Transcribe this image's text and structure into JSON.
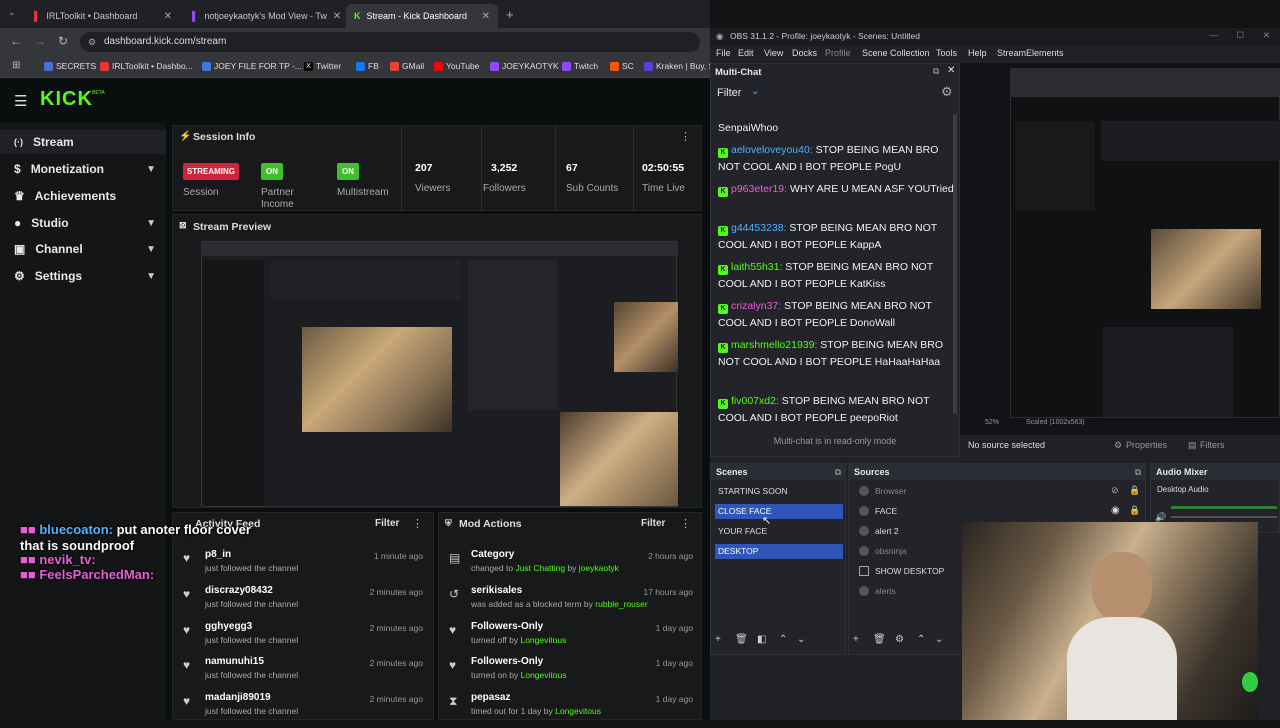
{
  "browser": {
    "tabs": [
      {
        "title": "IRLToolkit • Dashboard"
      },
      {
        "title": "notjoeykaotyk's Mod View - Tw"
      },
      {
        "title": "Stream - Kick Dashboard"
      }
    ],
    "url": "dashboard.kick.com/stream",
    "bookmarks": [
      "SECRETS",
      "IRLToolkit • Dashbo...",
      "JOEY FILE FOR TP -...",
      "Twitter",
      "FB",
      "GMail",
      "YouTube",
      "JOEYKAOTYK",
      "Twitch",
      "SC",
      "Kraken | Buy, S"
    ]
  },
  "kick": {
    "logo": "KICK",
    "logo_sup": "BETA",
    "nav": [
      {
        "label": "Stream",
        "has_chevron": false
      },
      {
        "label": "Monetization",
        "has_chevron": true
      },
      {
        "label": "Achievements",
        "has_chevron": false
      },
      {
        "label": "Studio",
        "has_chevron": true
      },
      {
        "label": "Channel",
        "has_chevron": true
      },
      {
        "label": "Settings",
        "has_chevron": true
      }
    ],
    "session_info": {
      "title": "Session Info",
      "streaming_badge": "STREAMING",
      "session_label": "Session",
      "partner_badge": "ON",
      "partner_label": "Partner Income",
      "multistream_badge": "ON",
      "multistream_label": "Multistream",
      "viewers_value": "207",
      "viewers_label": "Viewers",
      "followers_value": "3,252",
      "followers_label": "Followers",
      "subs_value": "67",
      "subs_label": "Sub Counts",
      "time_value": "02:50:55",
      "time_label": "Time Live"
    },
    "stream_preview_title": "Stream Preview",
    "activity_feed": {
      "title": "Activity Feed",
      "filter": "Filter",
      "items": [
        {
          "name": "p8_in",
          "sub": "just followed the channel",
          "time": "1 minute ago"
        },
        {
          "name": "discrazy08432",
          "sub": "just followed the channel",
          "time": "2 minutes ago"
        },
        {
          "name": "gghyegg3",
          "sub": "just followed the channel",
          "time": "2 minutes ago"
        },
        {
          "name": "namunuhi15",
          "sub": "just followed the channel",
          "time": "2 minutes ago"
        },
        {
          "name": "madanji89019",
          "sub": "just followed the channel",
          "time": "2 minutes ago"
        }
      ]
    },
    "mod_actions": {
      "title": "Mod Actions",
      "filter": "Filter",
      "items": [
        {
          "name": "Category",
          "pre": "changed to ",
          "hl": "Just Chatting",
          "mid": " by ",
          "user": "joeykaotyk",
          "time": "2 hours ago"
        },
        {
          "name": "serikisales",
          "pre": "was added as a blocked term by ",
          "hl": "",
          "mid": "",
          "user": "rubble_rouser",
          "time": "17 hours ago"
        },
        {
          "name": "Followers-Only",
          "pre": "turned off by ",
          "hl": "",
          "mid": "",
          "user": "Longevitous",
          "time": "1 day ago"
        },
        {
          "name": "Followers-Only",
          "pre": "turned on by ",
          "hl": "",
          "mid": "",
          "user": "Longevitous",
          "time": "1 day ago"
        },
        {
          "name": "pepasaz",
          "pre": "timed out for 1 day by ",
          "hl": "",
          "mid": "",
          "user": "Longevitous",
          "time": "1 day ago"
        }
      ]
    }
  },
  "overlay_chat": [
    {
      "user": "bluecoaton:",
      "text": " put anoter floor cover",
      "color": "#4fb3ff"
    },
    {
      "user": "",
      "text": "that is soundproof",
      "color": "#ffffff"
    },
    {
      "user": "nevik_tv:",
      "text": "",
      "color": "#e85fd5"
    },
    {
      "user": "FeelsParchedMan:",
      "text": "",
      "color": "#e85fd5"
    }
  ],
  "obs": {
    "title": "OBS 31.1.2 - Profile: joeykaotyk - Scenes: Untitled",
    "menu": [
      "File",
      "Edit",
      "View",
      "Docks",
      "Profile",
      "Scene Collection",
      "Tools",
      "Help",
      "StreamElements"
    ],
    "multichat": {
      "title": "Multi-Chat",
      "filter": "Filter",
      "readonly": "Multi-chat is in read-only mode",
      "messages": [
        {
          "user": "",
          "text": "SenpaiWhoo",
          "color": "#f0f0f0"
        },
        {
          "user": "aeloveloveyou40:",
          "text": " STOP BEING MEAN BRO NOT COOL AND I BOT PEOPLE PogU",
          "color": "#4fb3ff"
        },
        {
          "user": "p963eter19:",
          "text": " WHY ARE U MEAN ASF YOUTried",
          "color": "#e85fd5"
        },
        {
          "user": "g44453238:",
          "text": " STOP BEING MEAN BRO NOT COOL AND I BOT PEOPLE KappA",
          "color": "#4fb3ff"
        },
        {
          "user": "laith55h31:",
          "text": " STOP BEING MEAN BRO NOT COOL AND I BOT PEOPLE KatKiss",
          "color": "#53fc18"
        },
        {
          "user": "crizalyn37:",
          "text": " STOP BEING MEAN BRO NOT COOL AND I BOT PEOPLE DonoWall",
          "color": "#e85fd5"
        },
        {
          "user": "marshmello21939:",
          "text": " STOP BEING MEAN BRO NOT COOL AND I BOT PEOPLE HaHaaHaHaa",
          "color": "#53fc18"
        },
        {
          "user": "fiv007xd2:",
          "text": " STOP BEING MEAN BRO NOT COOL AND I BOT PEOPLE peepoRiot",
          "color": "#53fc18"
        }
      ]
    },
    "preview_status": {
      "zoom": "52%",
      "scaled": "Scaled (1002x563)"
    },
    "no_source": "No source selected",
    "properties": "Properties",
    "filters": "Filters",
    "scenes": {
      "title": "Scenes",
      "items": [
        {
          "label": "STARTING SOON",
          "selected": false
        },
        {
          "label": "CLOSE FACE",
          "selected": true
        },
        {
          "label": "YOUR FACE",
          "selected": false
        },
        {
          "label": "DESKTOP",
          "selected": true
        }
      ]
    },
    "sources": {
      "title": "Sources",
      "items": [
        "Browser",
        "FACE",
        "alert 2",
        "obsninja",
        "SHOW DESKTOP",
        "alerts"
      ]
    },
    "audio_mixer": {
      "title": "Audio Mixer",
      "channel": "Desktop Audio"
    }
  },
  "colors": {
    "kick_green": "#53fc18",
    "streaming_red": "#d0243c",
    "obs_selection": "#3055b8"
  }
}
